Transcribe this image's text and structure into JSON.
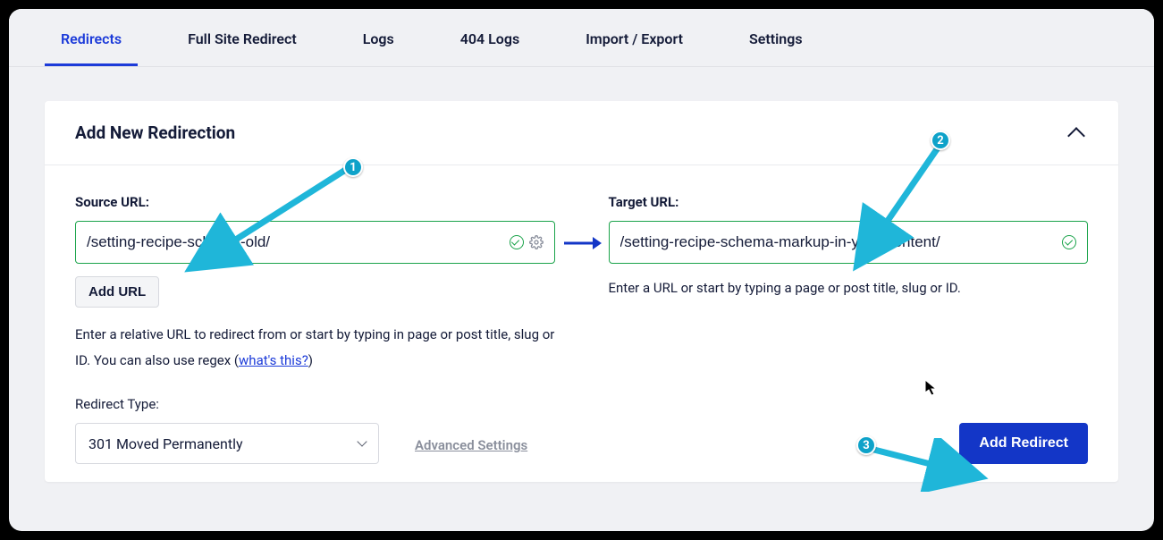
{
  "tabs": [
    {
      "label": "Redirects",
      "active": true
    },
    {
      "label": "Full Site Redirect",
      "active": false
    },
    {
      "label": "Logs",
      "active": false
    },
    {
      "label": "404 Logs",
      "active": false
    },
    {
      "label": "Import / Export",
      "active": false
    },
    {
      "label": "Settings",
      "active": false
    }
  ],
  "panel": {
    "title": "Add New Redirection"
  },
  "source": {
    "label": "Source URL:",
    "value": "/setting-recipe-schema-old/",
    "add_url_label": "Add URL",
    "help_prefix": "Enter a relative URL to redirect from or start by typing in page or post title, slug or ID. You can also use regex (",
    "help_link": "what's this?",
    "help_suffix": ")"
  },
  "target": {
    "label": "Target URL:",
    "value": "/setting-recipe-schema-markup-in-your-content/",
    "help": "Enter a URL or start by typing a page or post title, slug or ID."
  },
  "redirect_type": {
    "label": "Redirect Type:",
    "selected": "301 Moved Permanently"
  },
  "advanced_settings_label": "Advanced Settings",
  "add_redirect_label": "Add Redirect",
  "annotations": {
    "1": "1",
    "2": "2",
    "3": "3"
  },
  "colors": {
    "accent_blue": "#1c3bd9",
    "valid_green": "#1aa34a",
    "annotation_teal": "#0ea2c9",
    "button_blue": "#1336c7"
  }
}
